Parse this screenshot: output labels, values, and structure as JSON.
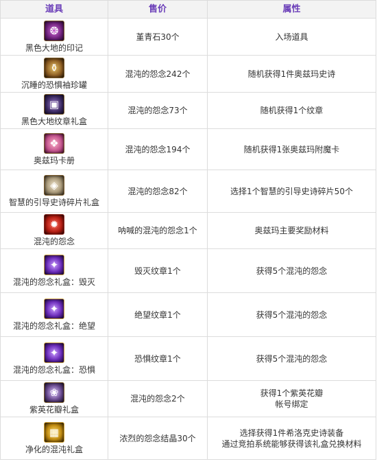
{
  "header": {
    "col_item": "道具",
    "col_price": "售价",
    "col_attr": "属性"
  },
  "rows": [
    {
      "icon": "emblem-icon",
      "name": "黑色大地的印记",
      "price": "堇青石30个",
      "attr": [
        "入场道具"
      ]
    },
    {
      "icon": "jar-icon",
      "name": "沉睡的恐惧袖珍罐",
      "price": "混沌的怨念242个",
      "attr": [
        "随机获得1件奥兹玛史诗"
      ]
    },
    {
      "icon": "chest-icon",
      "name": "黑色大地纹章礼盒",
      "price": "混沌的怨念73个",
      "attr": [
        "随机获得1个纹章"
      ]
    },
    {
      "icon": "card-book-icon",
      "name": "奥兹玛卡册",
      "price": "混沌的怨念194个",
      "attr": [
        "随机获得1张奥兹玛附魔卡"
      ]
    },
    {
      "icon": "shard-icon",
      "name": "智慧的引导史诗碎片礼盒",
      "price": "混沌的怨念82个",
      "attr": [
        "选择1个智慧的引导史诗碎片50个"
      ]
    },
    {
      "icon": "orb-icon",
      "name": "混沌的怨念",
      "price": "呐喊的混沌的怨念1个",
      "attr": [
        "奥兹玛主要奖励材料"
      ]
    },
    {
      "icon": "gift-box-icon",
      "name": "混沌的怨念礼盒：毁灭",
      "price": "毁灭纹章1个",
      "attr": [
        "获得5个混沌的怨念"
      ]
    },
    {
      "icon": "gift-box-icon",
      "name": "混沌的怨念礼盒：绝望",
      "price": "绝望纹章1个",
      "attr": [
        "获得5个混沌的怨念"
      ]
    },
    {
      "icon": "gift-box-icon",
      "name": "混沌的怨念礼盒：恐惧",
      "price": "恐惧纹章1个",
      "attr": [
        "获得5个混沌的怨念"
      ]
    },
    {
      "icon": "petal-icon",
      "name": "紫英花瓣礼盒",
      "price": "混沌的怨念2个",
      "attr": [
        "获得1个紫英花瓣",
        "帐号绑定"
      ]
    },
    {
      "icon": "gold-chest-icon",
      "name": "净化的混沌礼盒",
      "price": "浓烈的怨念结晶30个",
      "attr": [
        "选择获得1件希洛克史诗装备",
        "通过竞拍系统能够获得该礼盒兑换材料"
      ]
    }
  ]
}
